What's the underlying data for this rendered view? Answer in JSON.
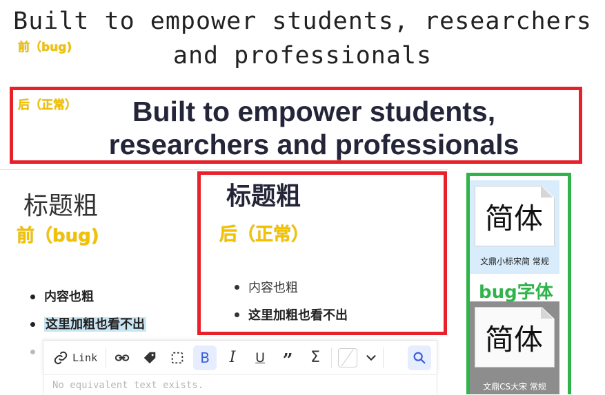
{
  "top": {
    "heading_before_line1": "Built to empower students, researchers",
    "heading_before_line2": "and professionals",
    "tag_before": "前（bug)",
    "tag_after": "后（正常）",
    "heading_after_line1": "Built to empower students,",
    "heading_after_line2": "researchers and professionals"
  },
  "editor_before": {
    "title": "标题粗",
    "tag": "前（bug)",
    "items": [
      "内容也粗",
      "这里加粗也看不出"
    ]
  },
  "editor_after": {
    "title": "标题粗",
    "tag": "后（正常）",
    "items": [
      "内容也粗",
      "这里加粗也看不出"
    ]
  },
  "toolbar": {
    "link_label": "Link",
    "link_icon": "link-icon",
    "icons": [
      "chain-icon",
      "tag-icon",
      "dashed-square-icon",
      "bold-icon",
      "italic-icon",
      "underline-icon",
      "quote-icon",
      "sigma-icon",
      "color-icon",
      "chevron-down-icon",
      "search-icon"
    ],
    "placeholder": "No equivalent text exists."
  },
  "fonts": {
    "bug_label": "bug字体",
    "cards": [
      {
        "glyph": "简体",
        "name": "文鼎小标宋简 常规"
      },
      {
        "glyph": "简体",
        "name": "文鼎CS大宋 常规"
      }
    ]
  },
  "colors": {
    "red_box": "#e8202a",
    "green_box": "#2fb34a",
    "tag_yellow": "#f2c200",
    "toolbar_active": "#3a5bd9"
  }
}
